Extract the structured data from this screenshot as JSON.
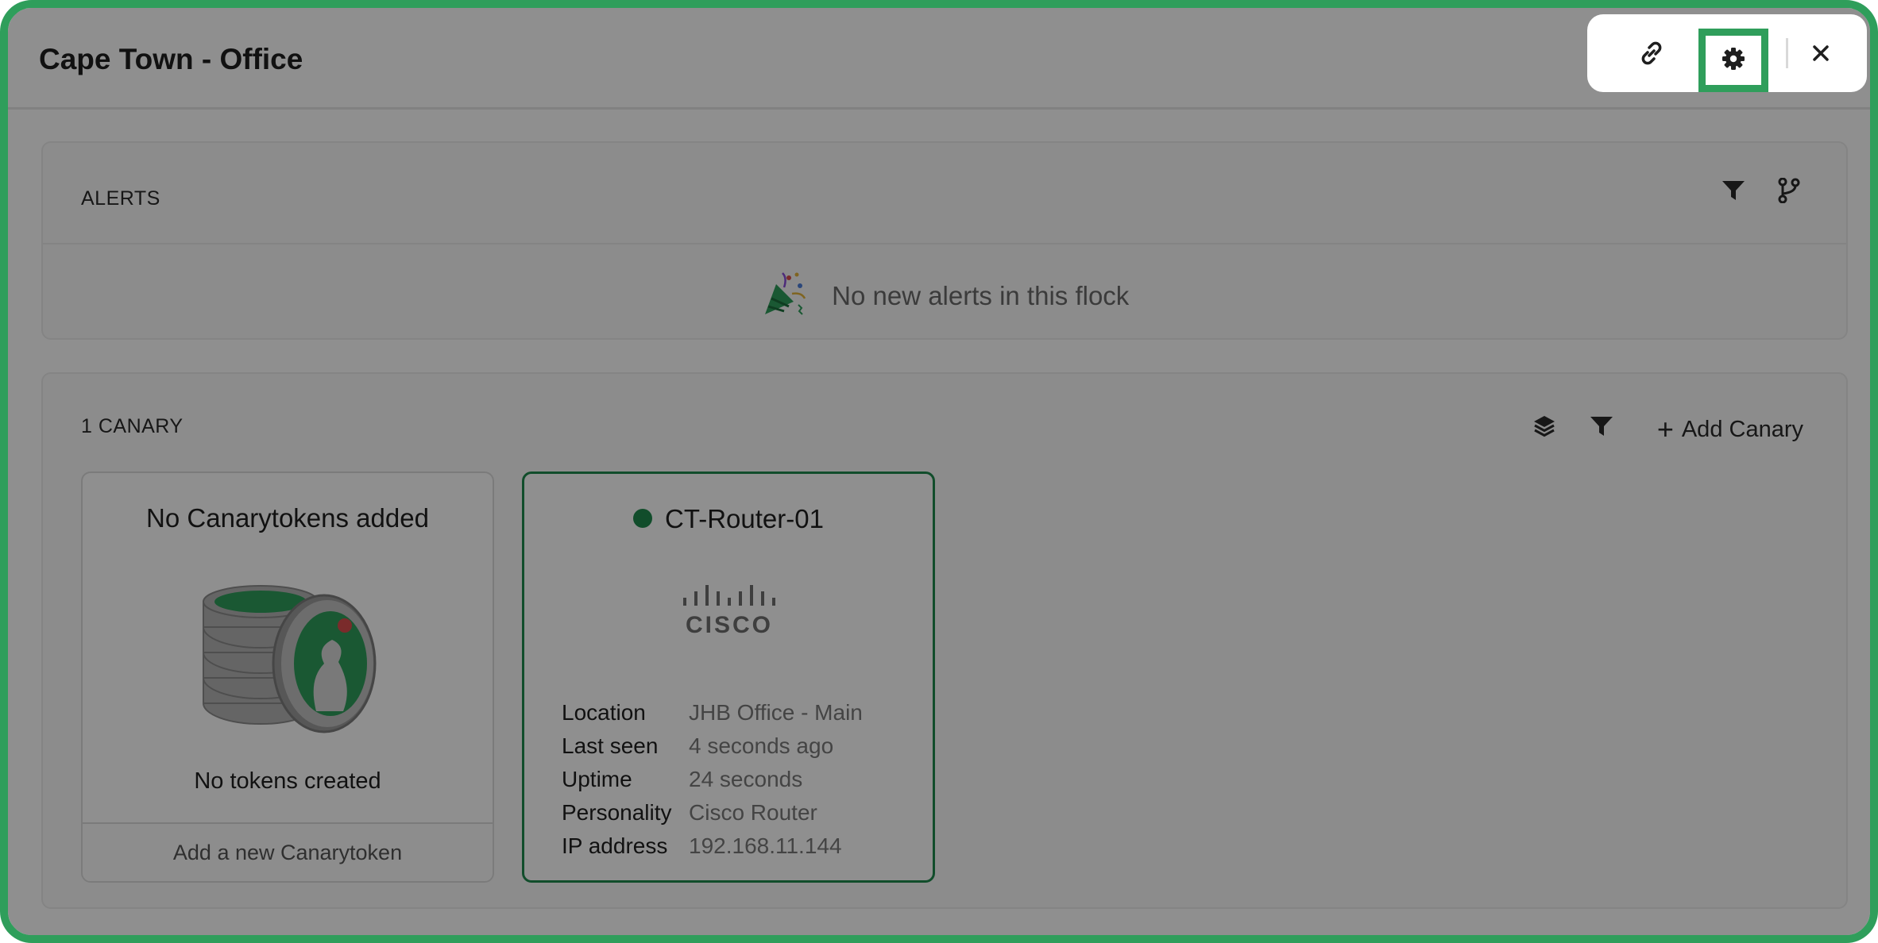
{
  "window": {
    "title": "Cape Town - Office"
  },
  "toolbar": {
    "link_icon": "link-icon",
    "settings_icon": "gear-icon",
    "close_icon": "close-icon"
  },
  "alerts": {
    "label": "ALERTS",
    "filter_icon": "filter-icon",
    "branch_icon": "branch-icon",
    "empty_icon": "party-popper-icon",
    "empty_message": "No new alerts in this flock"
  },
  "canaries": {
    "label": "1 CANARY",
    "layers_icon": "layers-icon",
    "filter_icon": "filter-icon",
    "add_button_label": "Add Canary",
    "tokens_card": {
      "title": "No Canarytokens added",
      "image_icon": "canary-coins-icon",
      "status": "No tokens created",
      "footer_link": "Add a new Canarytoken"
    },
    "device_card": {
      "name": "CT-Router-01",
      "status_color": "#1f8a4d",
      "logo": "cisco-logo",
      "logo_text": "CISCO",
      "details": [
        {
          "key": "Location",
          "value": "JHB Office - Main"
        },
        {
          "key": "Last seen",
          "value": "4 seconds ago"
        },
        {
          "key": "Uptime",
          "value": "24 seconds"
        },
        {
          "key": "Personality",
          "value": "Cisco Router"
        },
        {
          "key": "IP address",
          "value": "192.168.11.144"
        }
      ]
    }
  },
  "colors": {
    "highlight_border": "#2f9e5b",
    "accent_green": "#1f8a4d"
  }
}
